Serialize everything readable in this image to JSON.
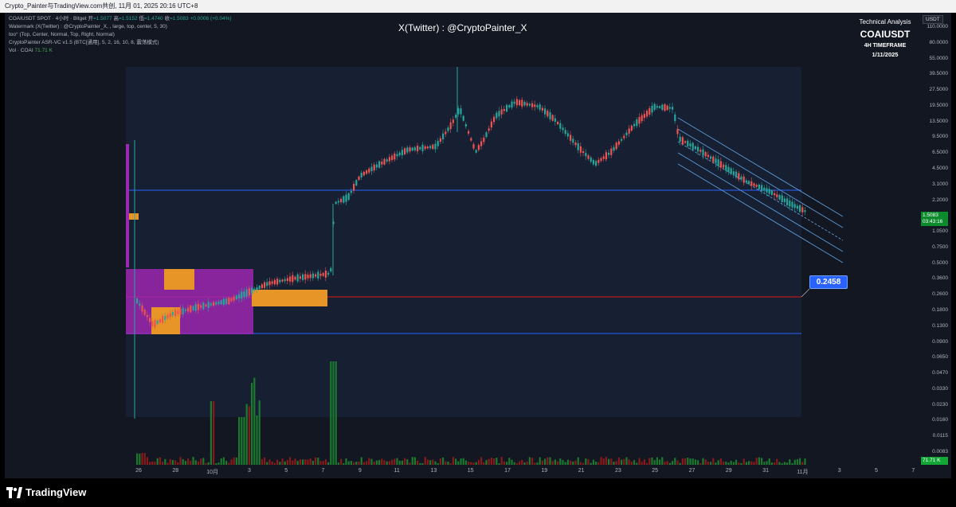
{
  "top_bar": {
    "text": "Crypto_Painter与TradingView.com共创, 11月 01, 2025 20:16 UTC+8"
  },
  "legend": {
    "symbol_line_prefix": "COAIUSDT SPOT · 4小时 · Bitget",
    "open_label": "开",
    "open_value": "=1.5077",
    "high_label": "高",
    "high_value": "=1.5152",
    "low_label": "低",
    "low_value": "=1.4740",
    "close_label": "收",
    "close_value": "=1.5083",
    "change": "+0.0006 (+0.04%)",
    "line2": "Watermark (X(Twitter) : @CryptoPainter_X, , large, top, center, 5, 30)",
    "line3": "too° (Top, Center, Normal, Top, Right, Normal)",
    "line4": "CryptoPainter ASR-VC v1.5 (BTC[通用], 5, 2, 16, 10, 8, 震荡模式)",
    "vol_label": "Vol · COAI",
    "vol_value": "71.71 K"
  },
  "watermark": "X(Twitter) : @CryptoPainter_X",
  "analysis_box": {
    "title": "Technical Analysis",
    "symbol": "COAIUSDT",
    "timeframe": "4H TIMEFRAME",
    "date": "1/11/2025"
  },
  "price_axis": {
    "currency": "USDT",
    "labels": [
      "110.0000",
      "80.0000",
      "55.0000",
      "39.5000",
      "27.5000",
      "19.5000",
      "13.5000",
      "9.5000",
      "6.5000",
      "4.5000",
      "3.1000",
      "2.2000",
      "1.5000",
      "1.0500",
      "0.7500",
      "0.5000",
      "0.3600",
      "0.2600",
      "0.1800",
      "0.1300",
      "0.0900",
      "0.0650",
      "0.0470",
      "0.0330",
      "0.0230",
      "0.0160",
      "0.0115",
      "0.0083"
    ],
    "last_price": "1.5083",
    "countdown": "03:43:16",
    "volume_badge": "71.71 K"
  },
  "time_axis": {
    "labels": [
      "26",
      "28",
      "10月",
      "3",
      "5",
      "7",
      "9",
      "11",
      "13",
      "15",
      "17",
      "19",
      "21",
      "23",
      "25",
      "27",
      "29",
      "31",
      "11月",
      "3",
      "5",
      "7"
    ]
  },
  "level_callout": {
    "value": "0.2458"
  },
  "colors": {
    "background": "#131722",
    "bull": "#26a69a",
    "bear": "#ef5350",
    "vol_bull": "#1b7a2e",
    "vol_bear": "#8a1a1a",
    "profile_purple": "#9c27b0",
    "profile_orange": "#e69526",
    "support_line": "#2962ff",
    "level_line": "#b71c1c",
    "channel": "#5b9bd5"
  },
  "footer": {
    "brand": "TradingView",
    "logo_icon": "tradingview-logo-icon"
  }
}
